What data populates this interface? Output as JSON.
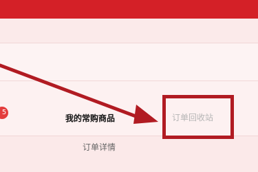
{
  "colors": {
    "header": "#d42027",
    "annotation": "#b11b22",
    "badge": "#e43d3d"
  },
  "badge": {
    "count": "5"
  },
  "tabs": {
    "frequent_products": "我的常购商品",
    "recycle_station": "订单回收站"
  },
  "order_detail": {
    "label": "订单详情"
  }
}
